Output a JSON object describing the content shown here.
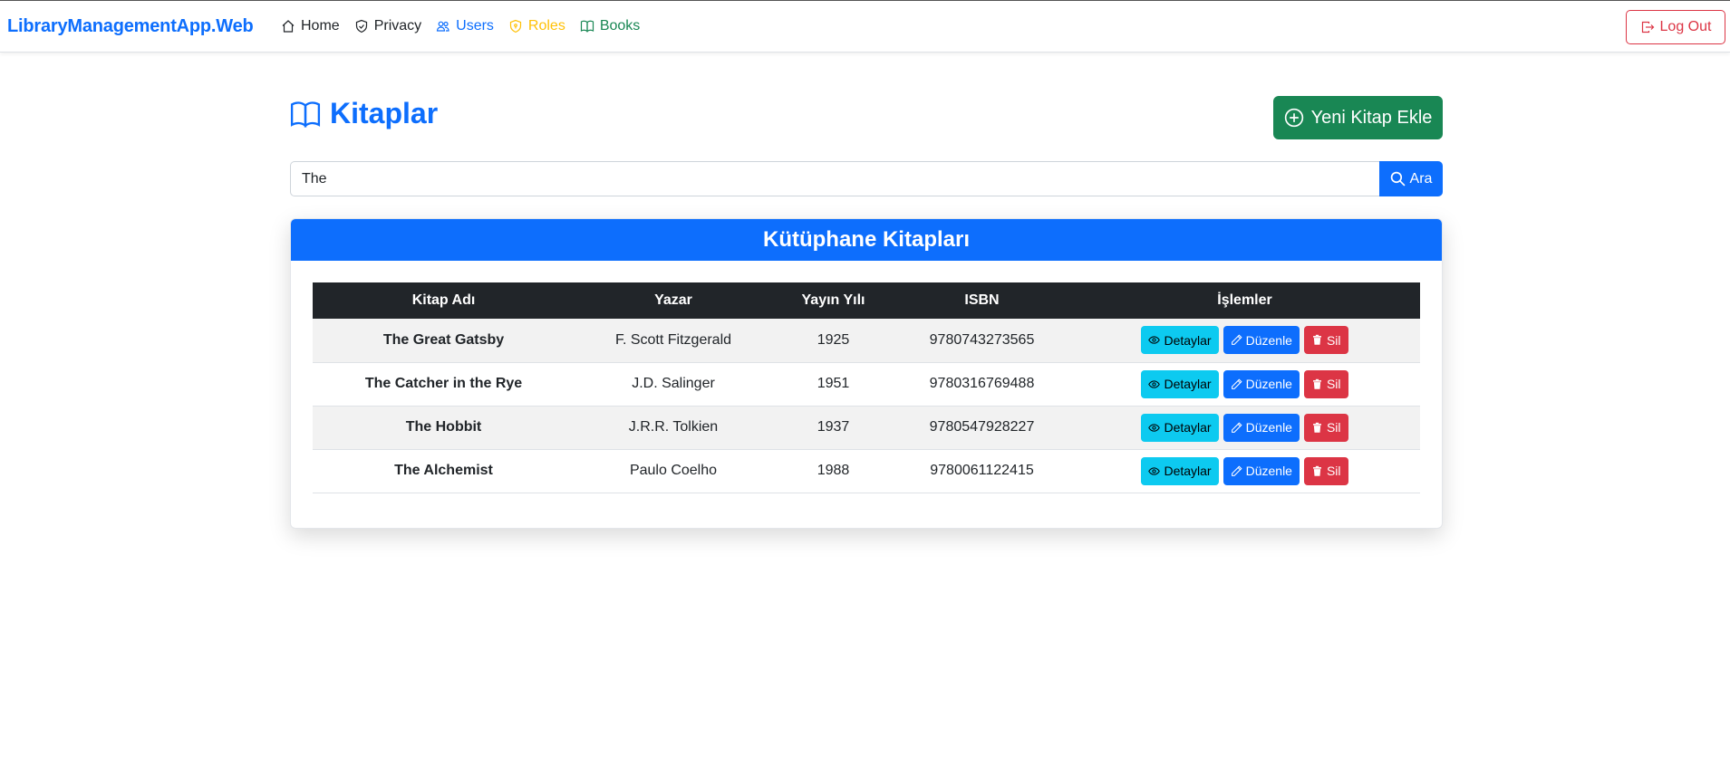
{
  "navbar": {
    "brand": "LibraryManagementApp.Web",
    "links": [
      {
        "label": "Home",
        "icon": "house-icon"
      },
      {
        "label": "Privacy",
        "icon": "shield-icon"
      },
      {
        "label": "Users",
        "icon": "people-icon"
      },
      {
        "label": "Roles",
        "icon": "shield-lock-icon"
      },
      {
        "label": "Books",
        "icon": "book-icon"
      }
    ],
    "logout_label": "Log Out",
    "colors": {
      "users": "#0d6efd",
      "roles": "#ffc107",
      "books": "#198754"
    }
  },
  "header": {
    "title": "Kitaplar",
    "add_button_label": "Yeni Kitap Ekle"
  },
  "search": {
    "value": "The",
    "button_label": "Ara"
  },
  "card": {
    "title": "Kütüphane Kitapları",
    "columns": [
      "Kitap Adı",
      "Yazar",
      "Yayın Yılı",
      "ISBN",
      "İşlemler"
    ],
    "rows": [
      {
        "title": "The Great Gatsby",
        "author": "F. Scott Fitzgerald",
        "year": "1925",
        "isbn": "9780743273565"
      },
      {
        "title": "The Catcher in the Rye",
        "author": "J.D. Salinger",
        "year": "1951",
        "isbn": "9780316769488"
      },
      {
        "title": "The Hobbit",
        "author": "J.R.R. Tolkien",
        "year": "1937",
        "isbn": "9780547928227"
      },
      {
        "title": "The Alchemist",
        "author": "Paulo Coelho",
        "year": "1988",
        "isbn": "9780061122415"
      }
    ],
    "actions": {
      "detail": "Detaylar",
      "edit": "Düzenle",
      "delete": "Sil"
    }
  },
  "theme": {
    "primary": "#0d6efd",
    "success": "#198754",
    "danger": "#dc3545",
    "info": "#0dcaf0",
    "dark": "#212529"
  }
}
